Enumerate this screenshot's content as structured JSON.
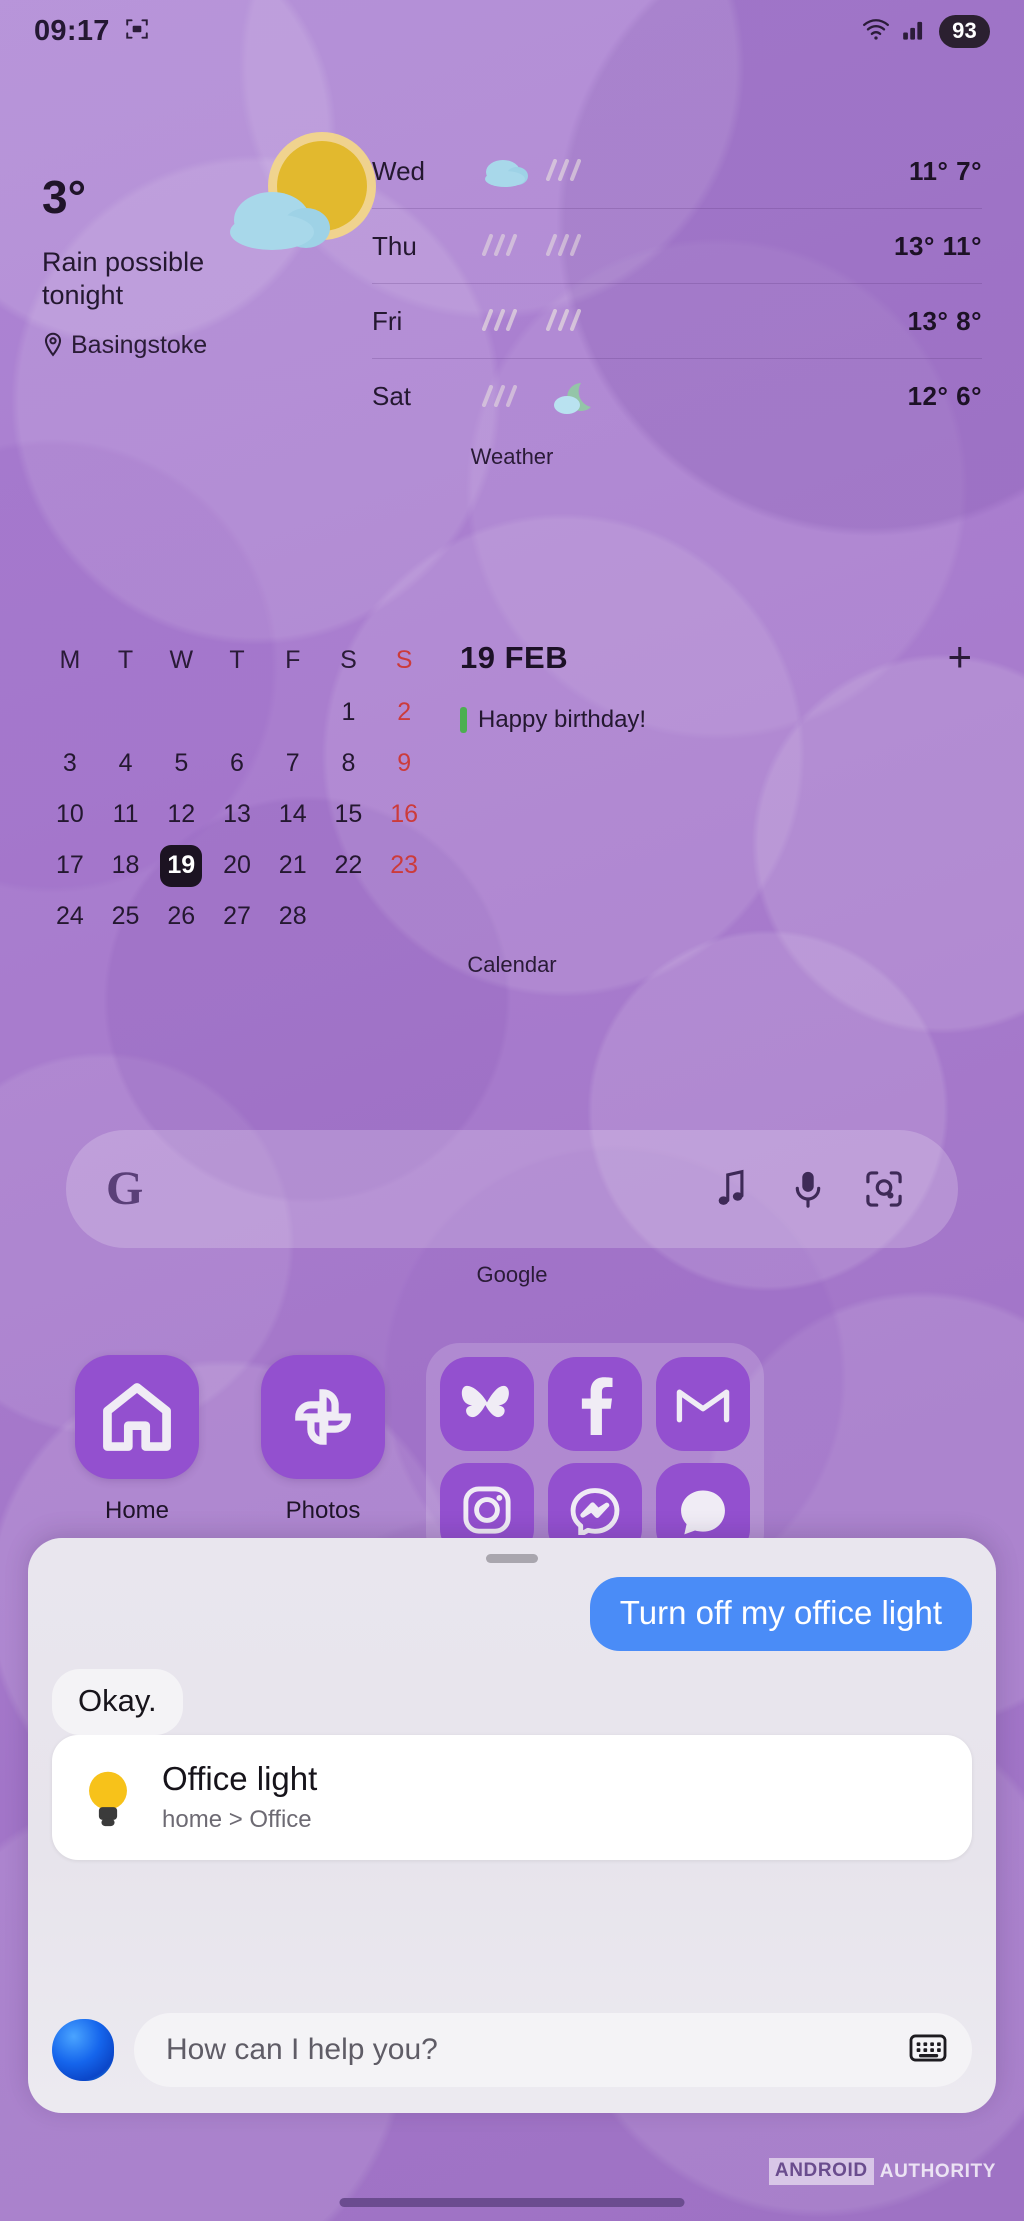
{
  "statusbar": {
    "time": "09:17",
    "icons": [
      "screenshot-icon",
      "wifi-icon",
      "signal-icon"
    ],
    "battery": "93"
  },
  "weather": {
    "temperature": "3°",
    "condition": "Rain possible tonight",
    "location": "Basingstoke",
    "location_icon": "location-pin-icon",
    "main_icon": "sun-behind-cloud-icon",
    "widget_label": "Weather",
    "forecast": [
      {
        "day": "Wed",
        "icons": [
          "cloud-icon",
          "rain-icon"
        ],
        "high": "11°",
        "low": "7°"
      },
      {
        "day": "Thu",
        "icons": [
          "rain-icon",
          "rain-icon"
        ],
        "high": "13°",
        "low": "11°"
      },
      {
        "day": "Fri",
        "icons": [
          "rain-icon",
          "rain-icon"
        ],
        "high": "13°",
        "low": "8°"
      },
      {
        "day": "Sat",
        "icons": [
          "rain-icon",
          "moon-cloud-icon"
        ],
        "high": "12°",
        "low": "6°"
      }
    ]
  },
  "calendar": {
    "widget_label": "Calendar",
    "weekday_headers": [
      "M",
      "T",
      "W",
      "T",
      "F",
      "S",
      "S"
    ],
    "weeks": [
      [
        "",
        "",
        "",
        "",
        "",
        "1",
        "2"
      ],
      [
        "3",
        "4",
        "5",
        "6",
        "7",
        "8",
        "9"
      ],
      [
        "10",
        "11",
        "12",
        "13",
        "14",
        "15",
        "16"
      ],
      [
        "17",
        "18",
        "19",
        "20",
        "21",
        "22",
        "23"
      ],
      [
        "24",
        "25",
        "26",
        "27",
        "28",
        "",
        ""
      ]
    ],
    "today": "19",
    "selected_date": "19 FEB",
    "add_label": "+",
    "event": {
      "title": "Happy birthday!",
      "color": "#4caf50"
    }
  },
  "google_search": {
    "logo": "google-g-logo",
    "widget_label": "Google",
    "actions": [
      "music-note-icon",
      "microphone-icon",
      "google-lens-icon"
    ]
  },
  "apps": [
    {
      "label": "Home",
      "icon": "google-home-icon"
    },
    {
      "label": "Photos",
      "icon": "google-photos-icon"
    }
  ],
  "folder": {
    "icons": [
      "bluesky-icon",
      "facebook-icon",
      "gmail-icon",
      "instagram-icon",
      "messenger-icon",
      "chat-icon"
    ]
  },
  "assistant": {
    "user_message": "Turn off my office light",
    "bot_message": "Okay.",
    "device_card": {
      "icon": "lightbulb-icon",
      "name": "Office light",
      "path": "home > Office"
    },
    "input_placeholder": "How can I help you?",
    "orb_icon": "gemini-orb-icon",
    "keyboard_icon": "keyboard-icon"
  },
  "watermark": {
    "brand": "ANDROID",
    "suffix": "AUTHORITY"
  }
}
